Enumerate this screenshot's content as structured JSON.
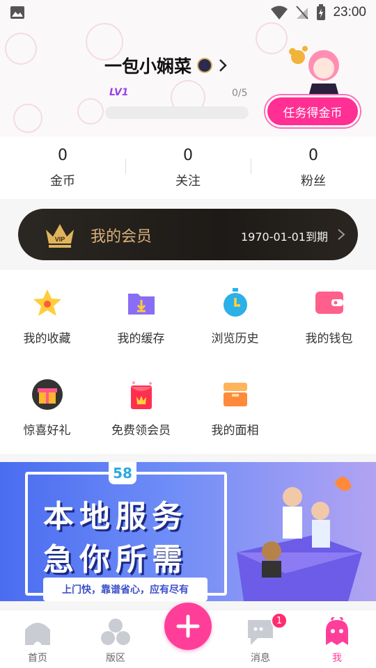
{
  "status_bar": {
    "time": "23:00"
  },
  "profile": {
    "username": "一包小娴菜",
    "level": "LV1",
    "progress_text": "0/5",
    "progress_fraction": 0,
    "task_button": "任务得金币"
  },
  "stats": [
    {
      "value": "0",
      "label": "金币"
    },
    {
      "value": "0",
      "label": "关注"
    },
    {
      "value": "0",
      "label": "粉丝"
    }
  ],
  "vip": {
    "title": "我的会员",
    "expire": "1970-01-01到期",
    "crown_text": "VIP"
  },
  "menu": [
    {
      "label": "我的收藏",
      "icon": "star-icon"
    },
    {
      "label": "我的缓存",
      "icon": "download-folder-icon"
    },
    {
      "label": "浏览历史",
      "icon": "stopwatch-icon"
    },
    {
      "label": "我的钱包",
      "icon": "wallet-icon"
    },
    {
      "label": "惊喜好礼",
      "icon": "gift-icon"
    },
    {
      "label": "免费领会员",
      "icon": "red-envelope-icon"
    },
    {
      "label": "我的面相",
      "icon": "box-icon"
    }
  ],
  "banner": {
    "logo": "58",
    "line1": "本地服务",
    "line2": "急你所需",
    "subtitle": "上门快，靠谱省心，应有尽有"
  },
  "tabbar": {
    "items": [
      {
        "label": "首页",
        "icon": "home-icon"
      },
      {
        "label": "版区",
        "icon": "board-icon"
      },
      {
        "label": "消息",
        "icon": "message-icon",
        "badge": "1"
      },
      {
        "label": "我",
        "icon": "profile-ghost-icon",
        "active": true
      }
    ]
  },
  "colors": {
    "accent": "#ff3e9a",
    "level": "#9b43e5",
    "vip_gold": "#d9b17a"
  }
}
